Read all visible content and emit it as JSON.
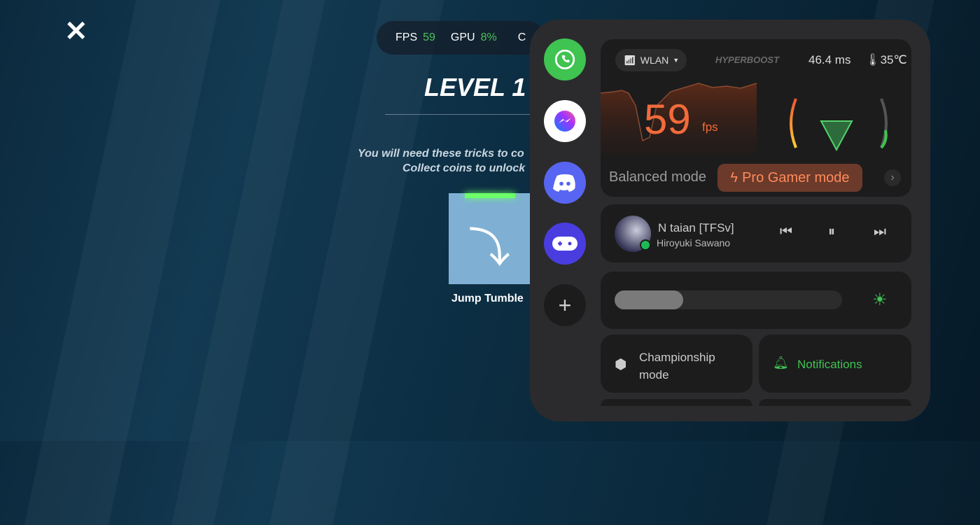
{
  "game": {
    "level_title": "LEVEL 1 -",
    "tip_line1": "You will need these tricks to co",
    "tip_line2": "Collect coins to unlock",
    "card_label": "Jump Tumble"
  },
  "stats": {
    "fps_label": "FPS",
    "fps_value": "59",
    "gpu_label": "GPU",
    "gpu_value": "8%",
    "cpu_label": "C"
  },
  "apps": [
    {
      "name": "WhatsApp",
      "color": "#3fc351"
    },
    {
      "name": "Messenger",
      "color": "#ffffff"
    },
    {
      "name": "Discord",
      "color": "#5865f2"
    },
    {
      "name": "Game",
      "color": "#4a3de0"
    }
  ],
  "perf": {
    "network": "WLAN",
    "brand": "HYPERBOOST",
    "latency": "46.4 ms",
    "temperature": "35℃",
    "fps_value": "59",
    "fps_unit": "fps",
    "mode_balanced": "Balanced mode",
    "mode_pro": "Pro Gamer mode"
  },
  "music": {
    "title": "N taian [TFSv]",
    "artist": "Hiroyuki Sawano"
  },
  "brightness": {
    "level_percent": 30
  },
  "tiles": {
    "championship": "Championship mode",
    "notifications": "Notifications"
  },
  "colors": {
    "accent_orange": "#f26b3a",
    "accent_green": "#3fc351"
  }
}
